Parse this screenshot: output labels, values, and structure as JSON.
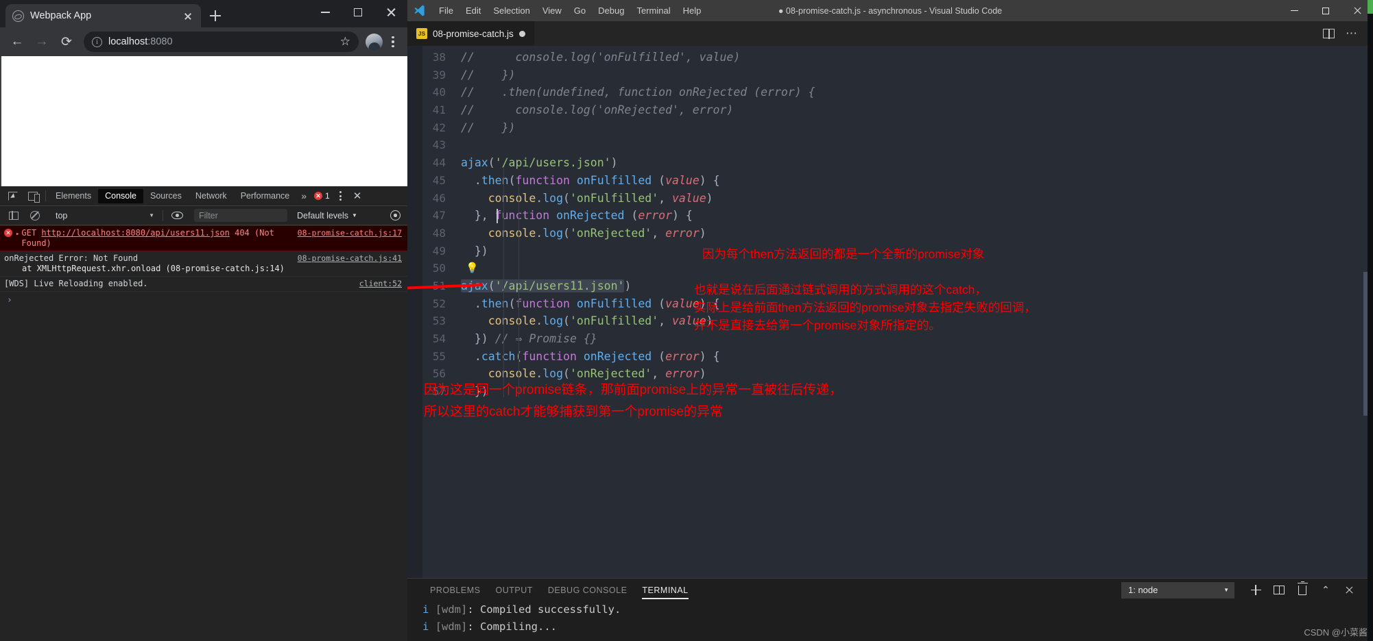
{
  "browser": {
    "tab": {
      "title": "Webpack App",
      "favicon_icon": "globe-icon",
      "close_icon": "close-icon"
    },
    "new_tab_icon": "plus-icon",
    "window_controls": {
      "minimize": "minimize-icon",
      "maximize": "maximize-icon",
      "close": "close-icon"
    },
    "toolbar": {
      "back_icon": "arrow-left-icon",
      "forward_icon": "arrow-right-icon",
      "reload_icon": "reload-icon",
      "info_icon": "info-circle-icon",
      "url_host": "localhost",
      "url_port": ":8080",
      "star_icon": "star-icon",
      "avatar_icon": "avatar-icon",
      "menu_icon": "kebab-menu-icon"
    }
  },
  "devtools": {
    "inspect_icon": "inspect-element-icon",
    "device_icon": "device-toolbar-icon",
    "tabs": [
      {
        "label": "Elements",
        "active": false
      },
      {
        "label": "Console",
        "active": true
      },
      {
        "label": "Sources",
        "active": false
      },
      {
        "label": "Network",
        "active": false
      },
      {
        "label": "Performance",
        "active": false
      }
    ],
    "more_tabs_icon": "chevron-right-icon",
    "error_count": "1",
    "kebab_icon": "kebab-menu-icon",
    "close_icon": "close-icon",
    "filterbar": {
      "sidebar_icon": "console-sidebar-icon",
      "clear_icon": "clear-console-icon",
      "context": "top",
      "eye_icon": "live-expression-icon",
      "filter_placeholder": "Filter",
      "levels": "Default levels",
      "settings_icon": "gear-icon"
    },
    "messages": [
      {
        "type": "error",
        "disclosure": "▸",
        "prefix": "GET ",
        "link": "http://localhost:8080/api/users11.json",
        "suffix": " 404 (Not Found)",
        "source": "08-promise-catch.js:17"
      },
      {
        "type": "plain",
        "text": "onRejected Error: Not Found",
        "sub": "at XMLHttpRequest.xhr.onload (08-promise-catch.js:14)",
        "source": "08-promise-catch.js:41"
      },
      {
        "type": "plain",
        "text": "[WDS] Live Reloading enabled.",
        "source": "client:52"
      }
    ],
    "prompt_symbol": "›"
  },
  "vscode": {
    "logo_icon": "vscode-logo-icon",
    "menu": [
      "File",
      "Edit",
      "Selection",
      "View",
      "Go",
      "Debug",
      "Terminal",
      "Help"
    ],
    "window_title": "08-promise-catch.js - asynchronous - Visual Studio Code",
    "title_dirty_dot": "●",
    "window_controls": {
      "minimize": "minimize-icon",
      "maximize": "maximize-icon",
      "close": "close-icon"
    },
    "tab": {
      "badge": "JS",
      "label": "08-promise-catch.js",
      "dirty_icon": "unsaved-dot-icon"
    },
    "tab_actions": {
      "split_icon": "split-editor-icon",
      "more_icon": "more-actions-icon"
    },
    "editor": {
      "lines": [
        {
          "n": "38",
          "html": "<span class=\"cm\">//      console.log('onFulfilled', value)</span>"
        },
        {
          "n": "39",
          "html": "<span class=\"cm\">//    })</span>"
        },
        {
          "n": "40",
          "html": "<span class=\"cm\">//    .then(undefined, function onRejected (error) {</span>"
        },
        {
          "n": "41",
          "html": "<span class=\"cm\">//      console.log('onRejected', error)</span>"
        },
        {
          "n": "42",
          "html": "<span class=\"cm\">//    })</span>"
        },
        {
          "n": "43",
          "html": ""
        },
        {
          "n": "44",
          "html": "<span class=\"fn\">ajax</span><span class=\"pn\">(</span><span class=\"str\">'/api/users.json'</span><span class=\"pn\">)</span>"
        },
        {
          "n": "45",
          "html": "  <span class=\"pn\">.</span><span class=\"fn\">then</span><span class=\"pn\">(</span><span class=\"kw\">function</span> <span class=\"fn\">onFulfilled</span> <span class=\"pn\">(</span><span class=\"par\">value</span><span class=\"pn\">) {</span>"
        },
        {
          "n": "46",
          "html": "    <span class=\"obj\">console</span><span class=\"pn\">.</span><span class=\"fn\">log</span><span class=\"pn\">(</span><span class=\"str\">'onFulfilled'</span><span class=\"pn\">, </span><span class=\"par\">value</span><span class=\"pn\">)</span>"
        },
        {
          "n": "47",
          "html": "  <span class=\"pn\">}, </span><span class=\"kw\">function</span> <span class=\"fn\">onRejected</span> <span class=\"pn\">(</span><span class=\"par\">error</span><span class=\"pn\">) {</span>"
        },
        {
          "n": "48",
          "html": "    <span class=\"obj\">console</span><span class=\"pn\">.</span><span class=\"fn\">log</span><span class=\"pn\">(</span><span class=\"str\">'onRejected'</span><span class=\"pn\">, </span><span class=\"par\">error</span><span class=\"pn\">)</span>"
        },
        {
          "n": "49",
          "html": "  <span class=\"pn\">})</span>"
        },
        {
          "n": "50",
          "html": ""
        },
        {
          "n": "51",
          "html": "<span class=\"hl-sel\"><span class=\"fn\">ajax</span><span class=\"pn\">(</span><span class=\"str\">'/api/users11.json'</span></span><span class=\"pn\">)</span>"
        },
        {
          "n": "52",
          "html": "  <span class=\"pn\">.</span><span class=\"fn\">then</span><span class=\"pn\">(</span><span class=\"kw\">function</span> <span class=\"fn\">onFulfilled</span> <span class=\"pn\">(</span><span class=\"par\">value</span><span class=\"pn\">) {</span>"
        },
        {
          "n": "53",
          "html": "    <span class=\"obj\">console</span><span class=\"pn\">.</span><span class=\"fn\">log</span><span class=\"pn\">(</span><span class=\"str\">'onFulfilled'</span><span class=\"pn\">, </span><span class=\"par\">value</span><span class=\"pn\">)</span>"
        },
        {
          "n": "54",
          "html": "  <span class=\"pn\">}) </span><span class=\"cm\">// ⇒ Promise {}</span>"
        },
        {
          "n": "55",
          "html": "  <span class=\"pn\">.</span><span class=\"fn\">catch</span><span class=\"pn\">(</span><span class=\"kw\">function</span> <span class=\"fn\">onRejected</span> <span class=\"pn\">(</span><span class=\"par\">error</span><span class=\"pn\">) {</span>"
        },
        {
          "n": "56",
          "html": "    <span class=\"obj\">console</span><span class=\"pn\">.</span><span class=\"fn\">log</span><span class=\"pn\">(</span><span class=\"str\">'onRejected'</span><span class=\"pn\">, </span><span class=\"par\">error</span><span class=\"pn\">)</span>"
        },
        {
          "n": "57",
          "html": "  <span class=\"pn\">})</span>"
        }
      ],
      "lightbulb_icon": "lightbulb-quickfix-icon"
    },
    "annotations": {
      "right_1": "因为每个then方法返回的都是一个全新的promise对象",
      "right_2_l1": "也就是说在后面通过链式调用的方式调用的这个catch，",
      "right_2_l2": "实际上是给前面then方法返回的promise对象去指定失败的回调，",
      "right_2_l3": "并不是直接去给第一个promise对象所指定的。",
      "bottom_l1": "因为这是同一个promise链条，那前面promise上的异常一直被往后传递，",
      "bottom_l2": "所以这里的catch才能够捕获到第一个promise的异常",
      "arrow_color": "#ff0000"
    },
    "panel": {
      "tabs": [
        {
          "label": "PROBLEMS",
          "active": false
        },
        {
          "label": "OUTPUT",
          "active": false
        },
        {
          "label": "DEBUG CONSOLE",
          "active": false
        },
        {
          "label": "TERMINAL",
          "active": true
        }
      ],
      "terminal_select": "1: node",
      "select_caret_icon": "chevron-down-icon",
      "new_terminal_icon": "plus-icon",
      "split_terminal_icon": "split-terminal-icon",
      "kill_terminal_icon": "trash-icon",
      "maximize_panel_icon": "chevron-up-icon",
      "close_panel_icon": "close-icon",
      "lines": [
        {
          "prefix": "i",
          "bracket": "[wdm]",
          "text": ": Compiled successfully."
        },
        {
          "prefix": "i",
          "bracket": "[wdm]",
          "text": ": Compiling..."
        }
      ]
    }
  },
  "watermark": "CSDN @小菜酱"
}
